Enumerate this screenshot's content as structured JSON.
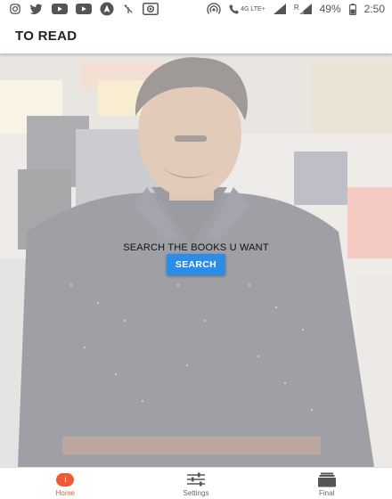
{
  "status_bar": {
    "left_icons": [
      "instagram-icon",
      "twitter-icon",
      "youtube-icon",
      "youtube-icon",
      "navigation-icon",
      "antenna-off-icon",
      "record-icon"
    ],
    "right_icons": [
      "hotspot-icon",
      "call-icon",
      "signal-icon",
      "signal-icon",
      "battery-icon"
    ],
    "network_label": "4G LTE+",
    "roaming_label": "R",
    "battery": "49%",
    "time": "2:50"
  },
  "app_bar": {
    "title": "TO READ"
  },
  "main": {
    "prompt": "SEARCH THE BOOKS U WANT",
    "search_button_label": "SEARCH"
  },
  "bottom_nav": {
    "items": [
      {
        "label": "Home",
        "icon": "info-badge-icon",
        "badge": "i",
        "active": true
      },
      {
        "label": "Settings",
        "icon": "sliders-icon",
        "active": false
      },
      {
        "label": "Final",
        "icon": "stack-icon",
        "active": false
      }
    ]
  },
  "colors": {
    "accent": "#ef5a35",
    "button": "#2a8ee8",
    "app_bar": "#ffffff"
  }
}
